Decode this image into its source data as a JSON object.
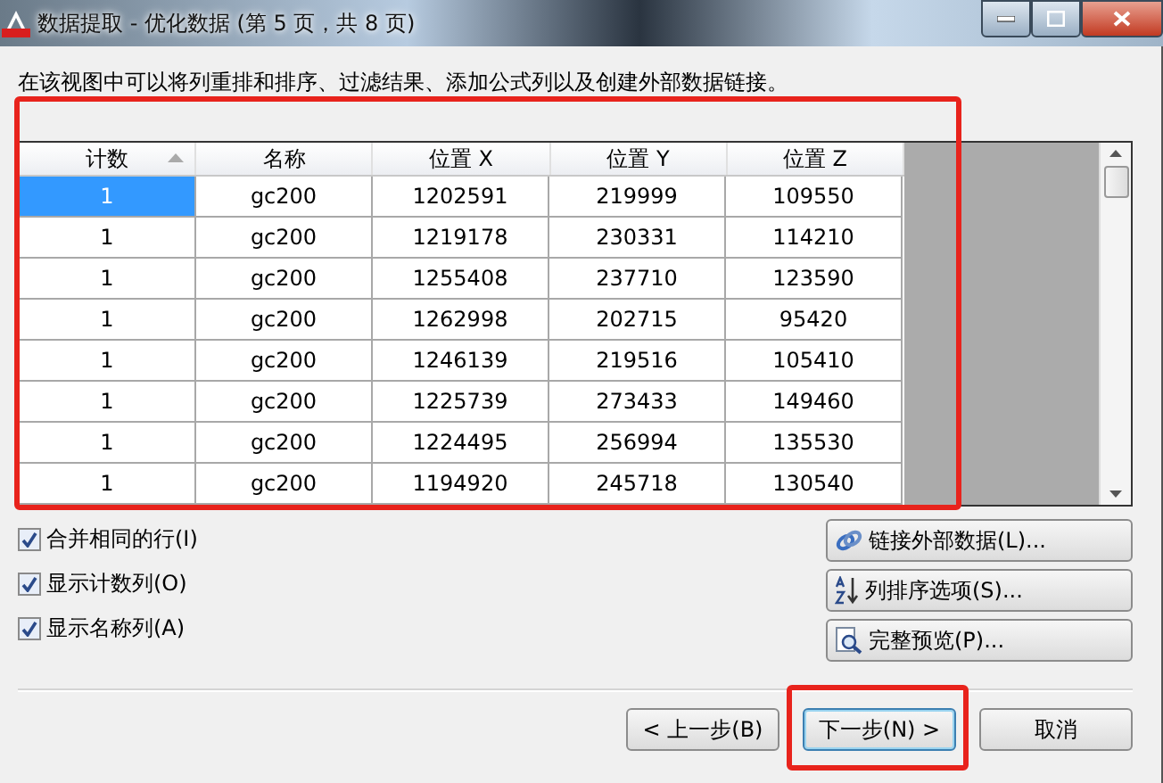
{
  "window": {
    "title": "数据提取 - 优化数据 (第 5 页，共 8 页)"
  },
  "instruction": "在该视图中可以将列重排和排序、过滤结果、添加公式列以及创建外部数据链接。",
  "table": {
    "highlighted": true,
    "columns": [
      {
        "label": "计数",
        "sorted": true
      },
      {
        "label": "名称",
        "sorted": false
      },
      {
        "label": "位置 X",
        "sorted": false
      },
      {
        "label": "位置 Y",
        "sorted": false
      },
      {
        "label": "位置 Z",
        "sorted": false
      }
    ],
    "rows": [
      {
        "selected": true,
        "cells": [
          "1",
          "gc200",
          "1202591",
          "219999",
          "109550"
        ]
      },
      {
        "selected": false,
        "cells": [
          "1",
          "gc200",
          "1219178",
          "230331",
          "114210"
        ]
      },
      {
        "selected": false,
        "cells": [
          "1",
          "gc200",
          "1255408",
          "237710",
          "123590"
        ]
      },
      {
        "selected": false,
        "cells": [
          "1",
          "gc200",
          "1262998",
          "202715",
          "95420"
        ]
      },
      {
        "selected": false,
        "cells": [
          "1",
          "gc200",
          "1246139",
          "219516",
          "105410"
        ]
      },
      {
        "selected": false,
        "cells": [
          "1",
          "gc200",
          "1225739",
          "273433",
          "149460"
        ]
      },
      {
        "selected": false,
        "cells": [
          "1",
          "gc200",
          "1224495",
          "256994",
          "135530"
        ]
      },
      {
        "selected": false,
        "cells": [
          "1",
          "gc200",
          "1194920",
          "245718",
          "130540"
        ]
      }
    ]
  },
  "options": [
    {
      "label": "合并相同的行(I)",
      "checked": true
    },
    {
      "label": "显示计数列(O)",
      "checked": true
    },
    {
      "label": "显示名称列(A)",
      "checked": true
    }
  ],
  "side_buttons": [
    {
      "label": "链接外部数据(L)...",
      "kind": "link"
    },
    {
      "label": "列排序选项(S)...",
      "kind": "sort"
    },
    {
      "label": "完整预览(P)...",
      "kind": "preview"
    }
  ],
  "nav_buttons": [
    {
      "label": "< 上一步(B)",
      "highlighted": false
    },
    {
      "label": "下一步(N) >",
      "highlighted": true
    },
    {
      "label": "取消",
      "highlighted": false
    }
  ]
}
